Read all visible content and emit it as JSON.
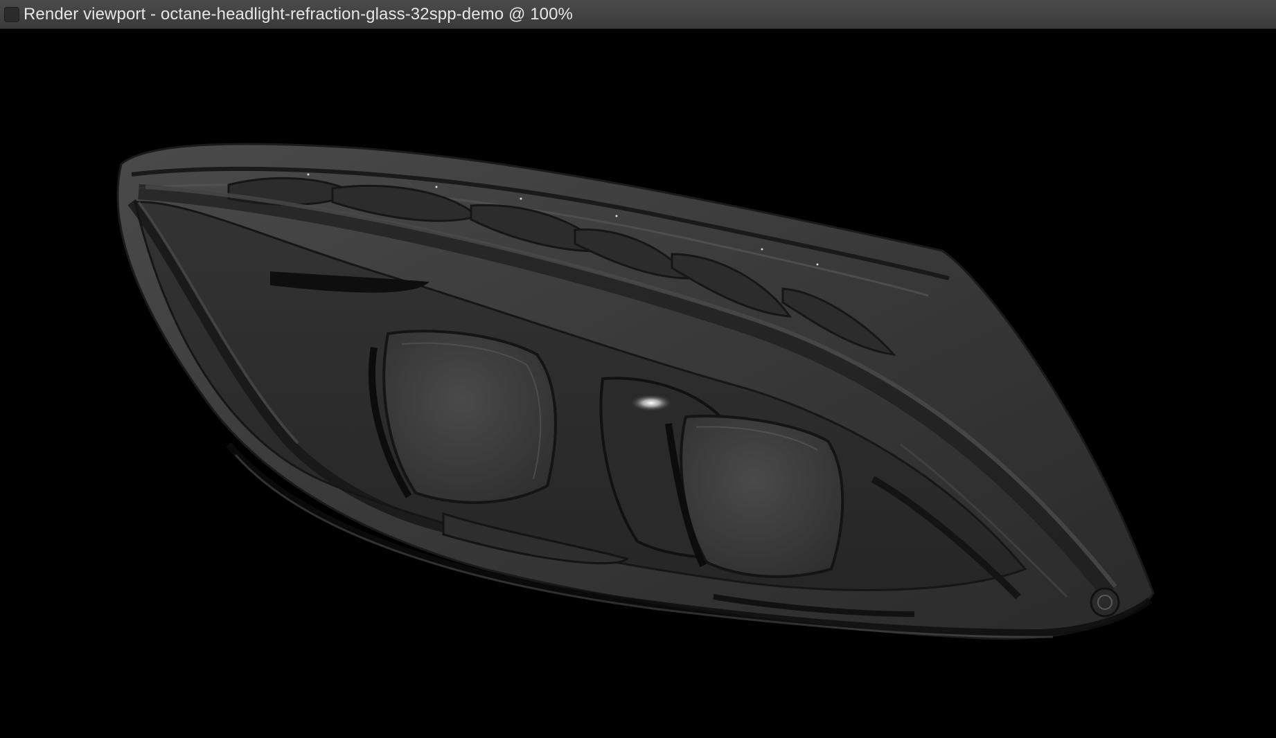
{
  "window": {
    "title": "Render viewport - octane-headlight-refraction-glass-32spp-demo @ 100%",
    "button_icon": "window-control-icon"
  },
  "viewport": {
    "background_color": "#000000",
    "subject": "headlight-render",
    "accent_colors": {
      "housing": "#3c3c3c",
      "housing_dark": "#262626",
      "highlight": "#f4f4f4"
    }
  }
}
